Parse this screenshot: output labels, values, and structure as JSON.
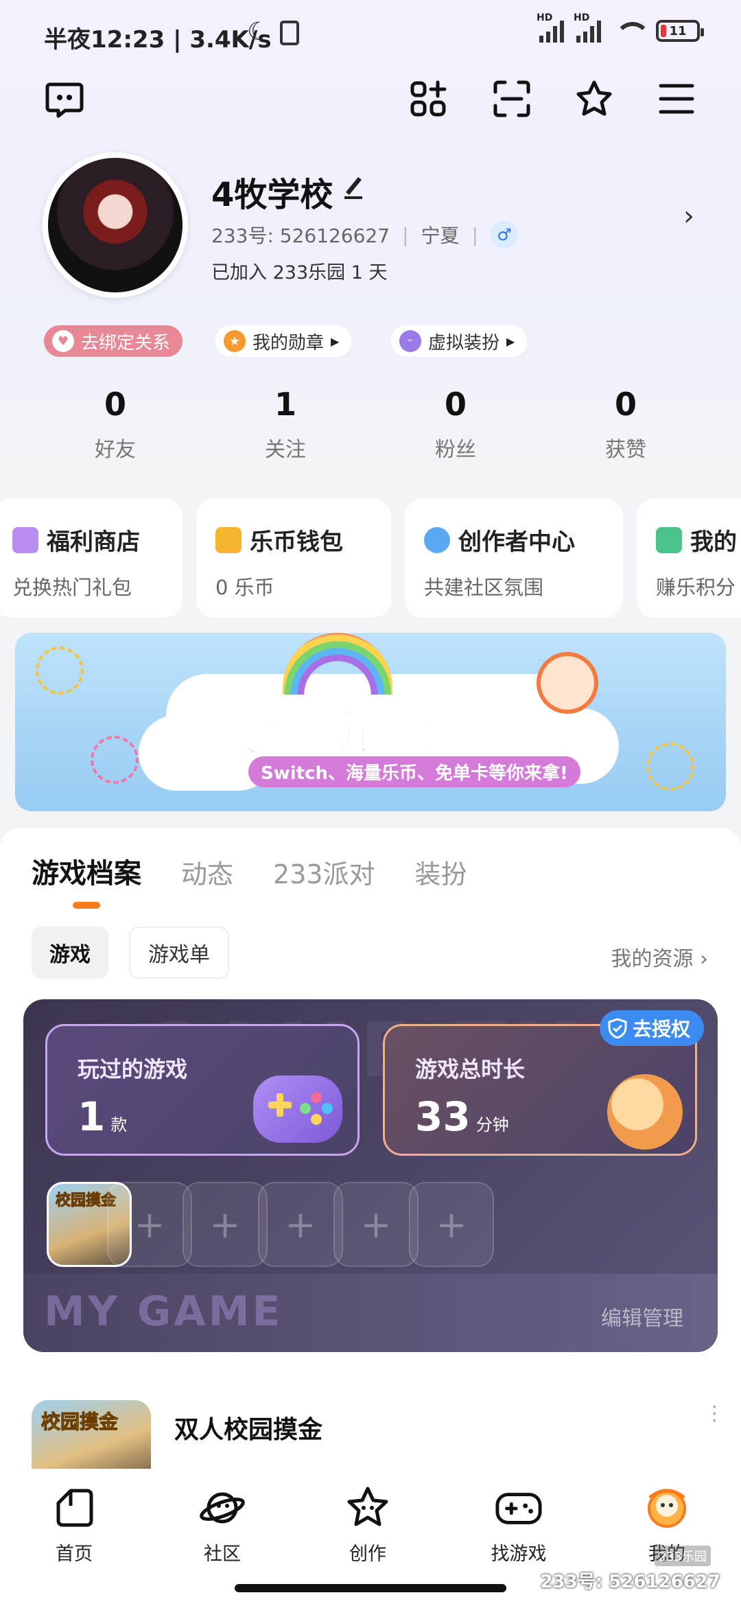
{
  "status_bar": {
    "time": "半夜12:23",
    "speed": "3.4K/s",
    "network_1": "HD",
    "network_2": "HD",
    "battery": "11"
  },
  "profile": {
    "name": "4牧学校",
    "id_label": "233号: 526126627",
    "region": "宁夏",
    "gender": "♂",
    "joined": "已加入 233乐园 1 天"
  },
  "pills": [
    {
      "label": "去绑定关系",
      "color": "#e88896"
    },
    {
      "label": "我的勋章"
    },
    {
      "label": "虚拟装扮"
    }
  ],
  "stats": [
    {
      "value": "0",
      "label": "好友"
    },
    {
      "value": "1",
      "label": "关注"
    },
    {
      "value": "0",
      "label": "粉丝"
    },
    {
      "value": "0",
      "label": "获赞"
    }
  ],
  "services": [
    {
      "title": "福利商店",
      "sub": "兑换热门礼包",
      "icon": "gift-icon",
      "color": "#b98cf0"
    },
    {
      "title": "乐币钱包",
      "sub": "0 乐币",
      "icon": "wallet-icon",
      "color": "#f5b52e"
    },
    {
      "title": "创作者中心",
      "sub": "共建社区氛围",
      "icon": "planet-icon",
      "color": "#5aa8f2"
    },
    {
      "title": "我的",
      "sub": "赚乐积分",
      "icon": "book-icon",
      "color": "#4cc38a"
    }
  ],
  "banner": {
    "title": "快乐充能站",
    "subtitle": "Switch、海量乐币、免单卡等你来拿!"
  },
  "tabs": [
    "游戏档案",
    "动态",
    "233派对",
    "装扮"
  ],
  "chips": [
    "游戏",
    "游戏单"
  ],
  "my_resources": "我的资源 ›",
  "game_card": {
    "bg_text": "GAME TIME",
    "played_label": "玩过的游戏",
    "played_value": "1",
    "played_unit": "款",
    "duration_label": "游戏总时长",
    "duration_value": "33",
    "duration_unit": "分钟",
    "auth_label": "去授权",
    "slot_game": "校园摸金",
    "empty_slot": "+",
    "footer_bg": "MY GAME",
    "edit": "编辑管理"
  },
  "game_row": {
    "thumb_label": "校园摸金",
    "name": "双人校园摸金"
  },
  "nav": [
    {
      "label": "首页",
      "icon": "home-icon"
    },
    {
      "label": "社区",
      "icon": "planet-icon"
    },
    {
      "label": "创作",
      "icon": "star-icon"
    },
    {
      "label": "找游戏",
      "icon": "gamepad-icon"
    },
    {
      "label": "我的",
      "icon": "profile-face-icon",
      "active": true
    }
  ],
  "watermark": {
    "small": "233乐园",
    "text": "233号: 526126627"
  }
}
